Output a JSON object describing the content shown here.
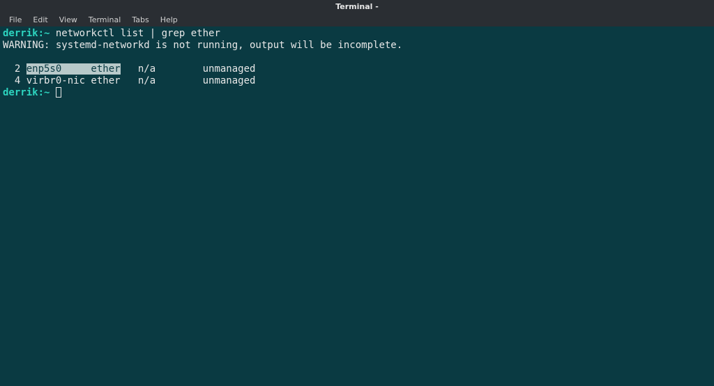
{
  "titlebar": {
    "title": "Terminal -"
  },
  "menubar": {
    "items": [
      "File",
      "Edit",
      "View",
      "Terminal",
      "Tabs",
      "Help"
    ]
  },
  "terminal": {
    "prompt": "derrik:~",
    "command": "networkctl list | grep ether",
    "warning": "WARNING: systemd-networkd is not running, output will be incomplete.",
    "rows": [
      {
        "index": "  2 ",
        "highlighted": "enp5s0     ether",
        "rest": "   n/a        unmanaged"
      },
      {
        "index": "  4 ",
        "plain": "virbr0-nic ether   n/a        unmanaged"
      }
    ]
  }
}
